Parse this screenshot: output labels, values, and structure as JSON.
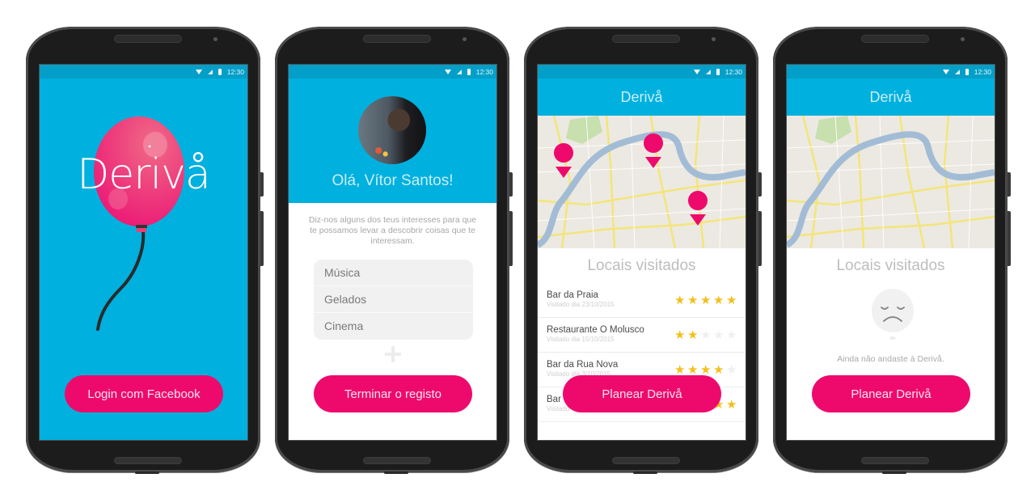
{
  "status_bar": {
    "time": "12:30"
  },
  "colors": {
    "primary_blue": "#00b0de",
    "status_blue": "#039fc8",
    "accent_pink": "#ee0a6d",
    "star_yellow": "#f2c01b"
  },
  "screens": [
    {
      "name": "login",
      "logo": "Derivå",
      "button": "Login com Facebook"
    },
    {
      "name": "register",
      "greeting": "Olá, Vítor Santos!",
      "intro": "Diz-nos alguns dos teus interesses para que te possamos levar a descobrir coisas que te interessam.",
      "interests": [
        "Música",
        "Gelados",
        "Cinema"
      ],
      "add_icon": "plus-icon",
      "button": "Terminar o registo"
    },
    {
      "name": "visited",
      "title": "Derivå",
      "section_title": "Locais visitados",
      "visits": [
        {
          "name": "Bar da Praia",
          "date": "Visitado dia 23/10/2015",
          "rating": 5
        },
        {
          "name": "Restaurante O Molusco",
          "date": "Visitado dia 15/10/2015",
          "rating": 2
        },
        {
          "name": "Bar da Rua Nova",
          "date": "Visitado dia 3/10/2015",
          "rating": 4
        },
        {
          "name": "Bar",
          "date": "Visitado",
          "rating": 5
        }
      ],
      "button": "Planear Derivå"
    },
    {
      "name": "empty",
      "title": "Derivå",
      "section_title": "Locais visitados",
      "empty_text": "Ainda não andaste à Derivå.",
      "button": "Planear Derivå"
    }
  ]
}
